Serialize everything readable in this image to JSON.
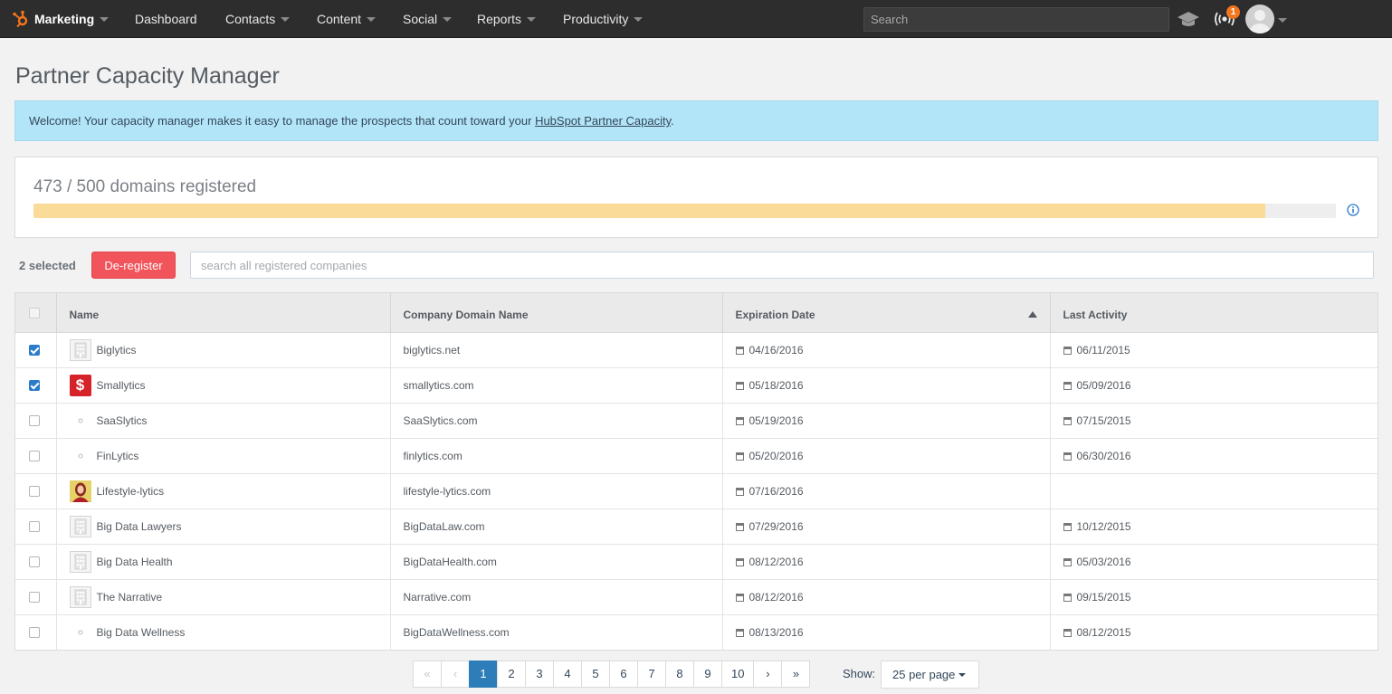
{
  "nav": {
    "brand": "Marketing",
    "items": [
      {
        "label": "Dashboard",
        "dropdown": false
      },
      {
        "label": "Contacts",
        "dropdown": true
      },
      {
        "label": "Content",
        "dropdown": true
      },
      {
        "label": "Social",
        "dropdown": true
      },
      {
        "label": "Reports",
        "dropdown": true
      },
      {
        "label": "Productivity",
        "dropdown": true
      }
    ],
    "search_placeholder": "Search",
    "notification_count": "1",
    "icons": [
      "hubspot-sprocket-icon",
      "graduation-cap-icon",
      "broadcast-icon",
      "user-avatar-icon"
    ],
    "accent_color": "#f2761e"
  },
  "page": {
    "title": "Partner Capacity Manager",
    "alert_text": "Welcome! Your capacity manager makes it easy to manage the prospects that count toward your ",
    "alert_link": "HubSpot Partner Capacity",
    "alert_end": ".",
    "capacity_text": "473 / 500 domains registered",
    "capacity_used": 473,
    "capacity_total": 500,
    "progress_color": "#fadc98"
  },
  "toolbar": {
    "selected_text": "2 selected",
    "deregister_label": "De-register",
    "search_placeholder": "search all registered companies",
    "deregister_color": "#f2545b"
  },
  "table": {
    "columns": [
      "Name",
      "Company Domain Name",
      "Expiration Date",
      "Last Activity"
    ],
    "sorted_column": "Expiration Date",
    "sort_direction": "ascending",
    "rows": [
      {
        "checked": true,
        "logo": "building",
        "name": "Biglytics",
        "domain": "biglytics.net",
        "expiration": "04/16/2016",
        "activity": "06/11/2015"
      },
      {
        "checked": true,
        "logo": "dollar",
        "name": "Smallytics",
        "domain": "smallytics.com",
        "expiration": "05/18/2016",
        "activity": "05/09/2016"
      },
      {
        "checked": false,
        "logo": "dot",
        "name": "SaaSlytics",
        "domain": "SaaSlytics.com",
        "expiration": "05/19/2016",
        "activity": "07/15/2015"
      },
      {
        "checked": false,
        "logo": "dot",
        "name": "FinLytics",
        "domain": "finlytics.com",
        "expiration": "05/20/2016",
        "activity": "06/30/2016"
      },
      {
        "checked": false,
        "logo": "photo",
        "name": "Lifestyle-lytics",
        "domain": "lifestyle-lytics.com",
        "expiration": "07/16/2016",
        "activity": ""
      },
      {
        "checked": false,
        "logo": "building",
        "name": "Big Data Lawyers",
        "domain": "BigDataLaw.com",
        "expiration": "07/29/2016",
        "activity": "10/12/2015"
      },
      {
        "checked": false,
        "logo": "building",
        "name": "Big Data Health",
        "domain": "BigDataHealth.com",
        "expiration": "08/12/2016",
        "activity": "05/03/2016"
      },
      {
        "checked": false,
        "logo": "building",
        "name": "The Narrative",
        "domain": "Narrative.com",
        "expiration": "08/12/2016",
        "activity": "09/15/2015"
      },
      {
        "checked": false,
        "logo": "dot",
        "name": "Big Data Wellness",
        "domain": "BigDataWellness.com",
        "expiration": "08/13/2016",
        "activity": "08/12/2015"
      },
      {
        "checked": false,
        "logo": "dot",
        "name": "",
        "domain": "",
        "expiration": "",
        "activity": ""
      }
    ]
  },
  "pagination": {
    "first": "«",
    "prev": "‹",
    "pages": [
      "1",
      "2",
      "3",
      "4",
      "5",
      "6",
      "7",
      "8",
      "9",
      "10"
    ],
    "current": "1",
    "next": "›",
    "last": "»",
    "show_label": "Show:",
    "per_page": "25 per page",
    "active_color": "#2d7db8"
  }
}
